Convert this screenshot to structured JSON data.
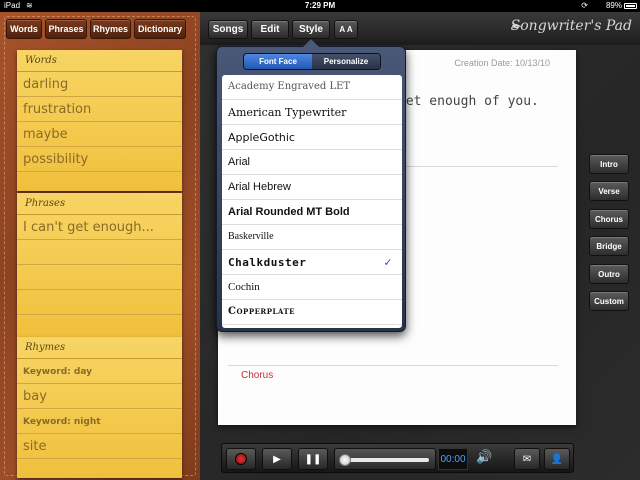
{
  "status": {
    "carrier": "iPad",
    "time": "7:29 PM",
    "battery": "89%"
  },
  "sidebar": {
    "tabs": [
      "Words",
      "Phrases",
      "Rhymes",
      "Dictionary"
    ],
    "words": {
      "title": "Words",
      "items": [
        "darling",
        "frustration",
        "maybe",
        "possibility"
      ]
    },
    "phrases": {
      "title": "Phrases",
      "items": [
        "I can't get enough..."
      ]
    },
    "rhymes": {
      "title": "Rhymes",
      "items": [
        {
          "keyword": "Keyword: day",
          "word": "bay"
        },
        {
          "keyword": "Keyword: night",
          "word": "site"
        }
      ]
    }
  },
  "toolbar": {
    "songs": "Songs",
    "edit": "Edit",
    "style": "Style",
    "text_size": "A A",
    "brand": "Songwriter's Pad"
  },
  "paper": {
    "creation_date": "Creation Date: 10/13/10",
    "lyric": "get enough of you.",
    "chorus": "Chorus"
  },
  "sections": [
    "Intro",
    "Verse",
    "Chorus",
    "Bridge",
    "Outro",
    "Custom"
  ],
  "popover": {
    "tab_font_face": "Font Face",
    "tab_personalize": "Personalize",
    "fonts": [
      "Academy Engraved LET",
      "American Typewriter",
      "AppleGothic",
      "Arial",
      "Arial Hebrew",
      "Arial Rounded MT Bold",
      "Baskerville",
      "Chalkduster",
      "Cochin",
      "Copperplate"
    ],
    "selected_font": "Chalkduster"
  },
  "player": {
    "counter": "00:00",
    "progress": 0.0
  },
  "colors": {
    "accent": "#2a4ea0",
    "chorus_label": "#c82e2e",
    "counter": "#4aa3ff"
  }
}
